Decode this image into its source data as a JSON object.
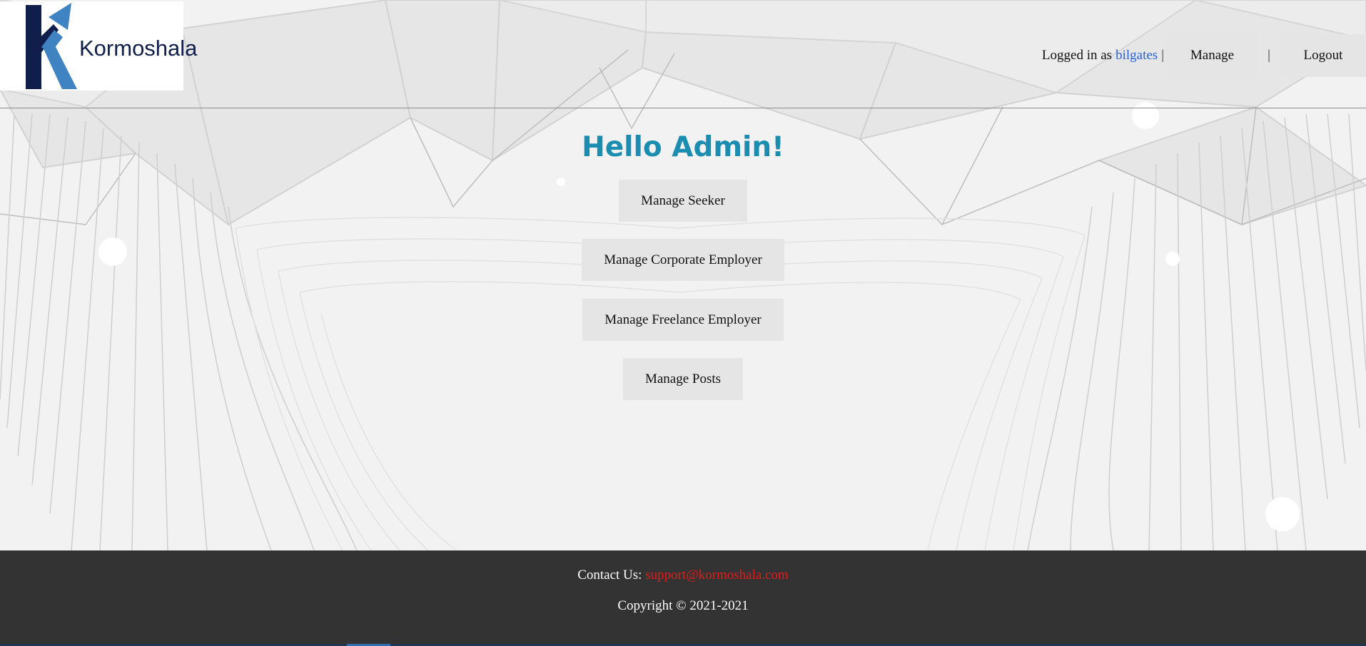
{
  "brand": {
    "name": "Kormoshala",
    "logo_icon": "k-arrow-logo",
    "colors": {
      "navy": "#0f1e4a",
      "blue": "#3f83c3"
    }
  },
  "nav": {
    "logged_in_prefix": "Logged in as",
    "username": "bilgates",
    "separator": "|",
    "manage_label": "Manage",
    "logout_label": "Logout"
  },
  "main": {
    "greeting": "Hello Admin!",
    "actions": [
      {
        "label": "Manage Seeker"
      },
      {
        "label": "Manage Corporate Employer"
      },
      {
        "label": "Manage Freelance Employer"
      },
      {
        "label": "Manage Posts"
      }
    ]
  },
  "footer": {
    "contact_label": "Contact Us:",
    "contact_email": "support@kormoshala.com",
    "copyright": "Copyright © 2021-2021"
  },
  "colors": {
    "greeting": "#1a8db0",
    "username_link": "#2962d8",
    "email_link": "#e21b1b",
    "footer_bg": "#333333",
    "button_bg": "#e5e5e5",
    "page_bg": "#f2f2f2"
  }
}
